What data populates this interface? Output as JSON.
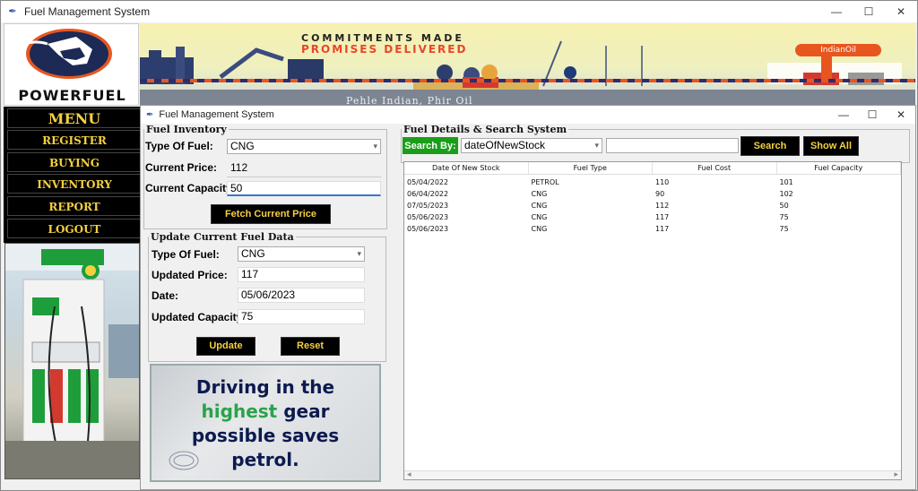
{
  "window": {
    "title": "Fuel Management System",
    "minimize": "—",
    "maximize": "☐",
    "close": "✕"
  },
  "logo": {
    "text": "POWERFUEL"
  },
  "banner": {
    "line1": "COMMITMENTS MADE",
    "line2": "PROMISES DELIVERED",
    "line3": "Pehle Indian, Phir Oil",
    "brand": "IndianOil"
  },
  "menu": {
    "title": "MENU",
    "items": [
      {
        "label": "REGISTER"
      },
      {
        "label": "BUYING"
      },
      {
        "label": "INVENTORY"
      },
      {
        "label": "REPORT"
      },
      {
        "label": "LOGOUT"
      }
    ]
  },
  "inner_window": {
    "title": "Fuel Management System",
    "minimize": "—",
    "maximize": "☐",
    "close": "✕"
  },
  "inventory": {
    "legend": "Fuel Inventory",
    "type_label": "Type Of Fuel:",
    "type_value": "CNG",
    "price_label": "Current Price:",
    "price_value": "112",
    "capacity_label": "Current Capacity:",
    "capacity_value": "50",
    "fetch_button": "Fetch Current Price"
  },
  "update": {
    "legend": "Update Current Fuel Data",
    "type_label": "Type Of Fuel:",
    "type_value": "CNG",
    "price_label": "Updated Price:",
    "price_value": "117",
    "date_label": "Date:",
    "date_value": "05/06/2023",
    "capacity_label": "Updated Capacity:",
    "capacity_value": "75",
    "update_button": "Update",
    "reset_button": "Reset"
  },
  "promo": {
    "line1": "Driving in the",
    "line2_green": "highest",
    "line2_rest": " gear",
    "line3": "possible saves",
    "line4": "petrol."
  },
  "search": {
    "legend": "Fuel Details & Search System",
    "search_by_label": "Search By:",
    "field_value": "dateOfNewStock",
    "query_value": "",
    "search_button": "Search",
    "show_all_button": "Show All"
  },
  "table": {
    "columns": [
      "Date Of New Stock",
      "Fuel Type",
      "Fuel Cost",
      "Fuel Capacity"
    ],
    "rows": [
      [
        "05/04/2022",
        "PETROL",
        "110",
        "101"
      ],
      [
        "06/04/2022",
        "CNG",
        "90",
        "102"
      ],
      [
        "07/05/2023",
        "CNG",
        "112",
        "50"
      ],
      [
        "05/06/2023",
        "CNG",
        "117",
        "75"
      ],
      [
        "05/06/2023",
        "CNG",
        "117",
        "75"
      ]
    ],
    "scroll_left": "◂",
    "scroll_right": "▸"
  },
  "colors": {
    "menu_text": "#f4d03f",
    "menu_bg": "#000000",
    "search_by_bg": "#1a9e1a",
    "promo_green": "#2aa34a",
    "promo_navy": "#0d1a4f",
    "banner_red": "#e8462a"
  }
}
